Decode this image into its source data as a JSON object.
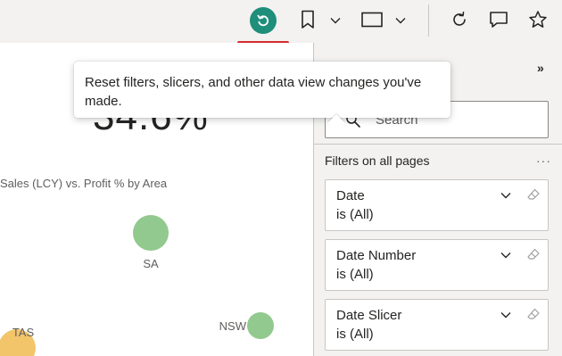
{
  "toolbar": {
    "icons": [
      "reset-icon",
      "bookmark-icon",
      "chevron-down-icon",
      "view-icon",
      "chevron-down-icon",
      "refresh-icon",
      "comment-icon",
      "star-icon"
    ],
    "reset_color": "#1f8e7a",
    "highlight_color": "#d62b2b"
  },
  "tooltip": {
    "text": "Reset filters, slicers, and other data view changes you've made."
  },
  "canvas": {
    "kpi_value": "34.6%",
    "chart_title": "Sales (LCY) vs. Profit % by Area"
  },
  "chart_data": {
    "type": "scatter",
    "title": "Sales (LCY) vs. Profit % by Area",
    "xlabel": "",
    "ylabel": "",
    "series": [
      {
        "points": [
          {
            "label": "SA",
            "color": "#92c98e"
          },
          {
            "label": "NSW",
            "color": "#92c98e"
          },
          {
            "label": "TAS",
            "color": "#f3c56b"
          }
        ]
      }
    ]
  },
  "filter_pane": {
    "search_placeholder": "Search",
    "section_title": "Filters on all pages",
    "more_label": "···",
    "collapse_label": "»",
    "filters": [
      {
        "name": "Date",
        "value": "is (All)"
      },
      {
        "name": "Date Number",
        "value": "is (All)"
      },
      {
        "name": "Date Slicer",
        "value": "is (All)"
      }
    ]
  }
}
